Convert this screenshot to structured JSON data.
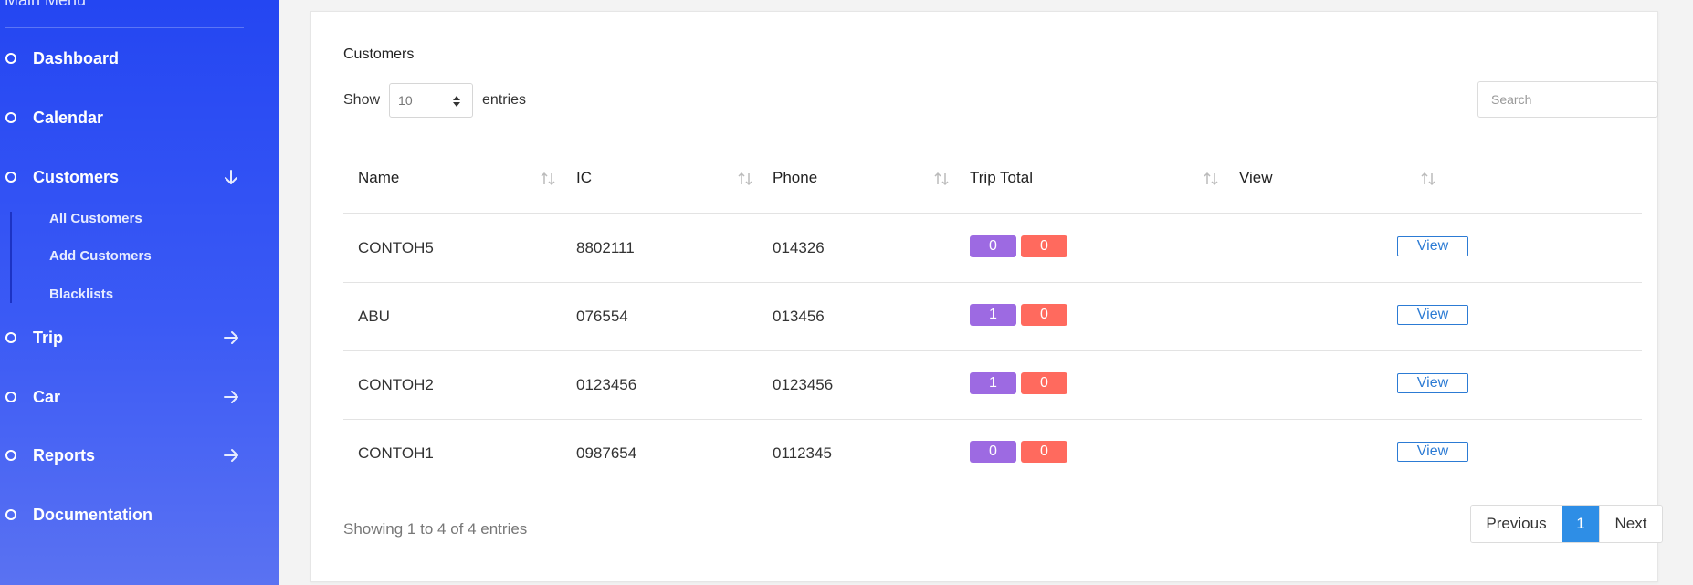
{
  "sidebar": {
    "menu_title": "Main Menu",
    "items": [
      {
        "label": "Dashboard"
      },
      {
        "label": "Calendar"
      },
      {
        "label": "Customers"
      },
      {
        "label": "Trip"
      },
      {
        "label": "Car"
      },
      {
        "label": "Reports"
      },
      {
        "label": "Documentation"
      }
    ],
    "customers_sub": [
      {
        "label": "All Customers"
      },
      {
        "label": "Add Customers"
      },
      {
        "label": "Blacklists"
      }
    ]
  },
  "card": {
    "title": "Customers",
    "show_label": "Show",
    "entries_value": "10",
    "entries_label": "entries",
    "search_placeholder": "Search"
  },
  "table": {
    "columns": [
      "Name",
      "IC",
      "Phone",
      "Trip Total",
      "View"
    ],
    "rows": [
      {
        "name": "CONTOH5",
        "ic": "8802111",
        "phone": "014326",
        "trip_a": "0",
        "trip_b": "0",
        "action": "View"
      },
      {
        "name": "ABU",
        "ic": "076554",
        "phone": "013456",
        "trip_a": "1",
        "trip_b": "0",
        "action": "View"
      },
      {
        "name": "CONTOH2",
        "ic": "0123456",
        "phone": "0123456",
        "trip_a": "1",
        "trip_b": "0",
        "action": "View"
      },
      {
        "name": "CONTOH1",
        "ic": "0987654",
        "phone": "0112345",
        "trip_a": "0",
        "trip_b": "0",
        "action": "View"
      }
    ]
  },
  "footer": {
    "info": "Showing 1 to 4 of 4 entries",
    "prev": "Previous",
    "page": "1",
    "next": "Next"
  },
  "colors": {
    "sidebar": "#2446f2",
    "badge_purple": "#9d6ae2",
    "badge_red": "#ff6a5e",
    "link_blue": "#2c7bd4",
    "page_active": "#2e8ee6"
  }
}
